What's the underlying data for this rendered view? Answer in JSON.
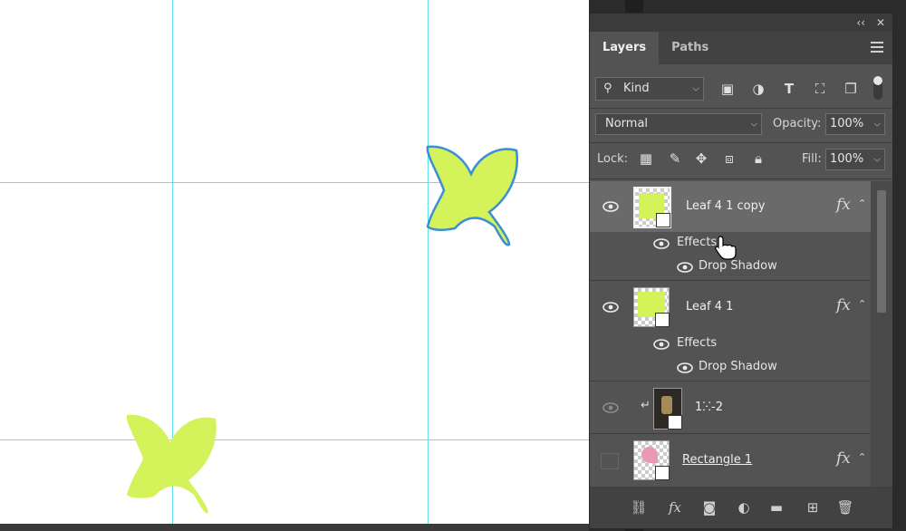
{
  "panel": {
    "top_buttons": [
      "‹‹",
      "✕"
    ],
    "tabs": [
      {
        "label": "Layers",
        "active": true
      },
      {
        "label": "Paths",
        "active": false
      }
    ],
    "filter": {
      "value": "Kind"
    },
    "blend_mode": "Normal",
    "opacity": {
      "label": "Opacity:",
      "value": "100%"
    },
    "lock": {
      "label": "Lock:"
    },
    "fill": {
      "label": "Fill:",
      "value": "100%"
    },
    "layers": [
      {
        "name": "Leaf 4 1 copy",
        "fx": "fx",
        "selected": true,
        "effects_label": "Effects",
        "effect": "Drop Shadow"
      },
      {
        "name": "Leaf 4 1",
        "fx": "fx",
        "selected": false,
        "effects_label": "Effects",
        "effect": "Drop Shadow"
      },
      {
        "name": "1ⵘ-2",
        "selected": false
      },
      {
        "name": "Rectangle 1",
        "fx": "fx",
        "selected": false
      }
    ]
  },
  "colors": {
    "leaf": "#d4f25a",
    "leaf_outline": "#3b8fd4",
    "guide": "#5ee3f0",
    "pink": "#e89ab4"
  }
}
